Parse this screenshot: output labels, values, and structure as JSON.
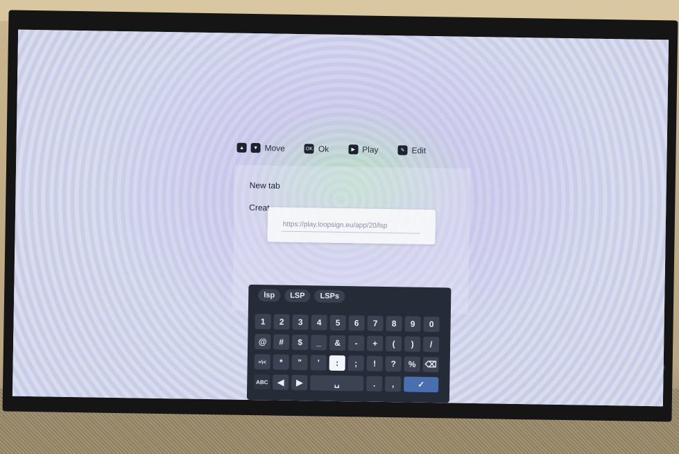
{
  "hints": [
    {
      "icon": "dpad-icon",
      "label": "Move"
    },
    {
      "icon": "ok-key-icon",
      "key_text": "OK",
      "label": "Ok"
    },
    {
      "icon": "play-icon",
      "label": "Play"
    },
    {
      "icon": "edit-icon",
      "label": "Edit"
    }
  ],
  "menu": {
    "new_tab": "New tab",
    "create": "Creat"
  },
  "url_dialog": {
    "value": "https://play.loopsign.eu/app/20/lsp"
  },
  "keyboard": {
    "suggestions": [
      "lsp",
      "LSP",
      "LSPs"
    ],
    "row1": [
      "1",
      "2",
      "3",
      "4",
      "5",
      "6",
      "7",
      "8",
      "9",
      "0"
    ],
    "row2": [
      "@",
      "#",
      "$",
      "_",
      "&",
      "-",
      "+",
      "(",
      ")",
      "/"
    ],
    "row3": [
      "=\\<",
      "*",
      "\"",
      "'",
      ":",
      ";",
      "!",
      "?",
      "%",
      "⌫"
    ],
    "row4": {
      "abc": "ABC",
      "left": "◀",
      "right": "▶",
      "space": "␣",
      "period": ".",
      "comma": ",",
      "enter": "✓"
    }
  },
  "colors": {
    "enter_key": "#4a6fb0",
    "keyboard_bg": "#252b37",
    "led": "#3fe07a"
  }
}
